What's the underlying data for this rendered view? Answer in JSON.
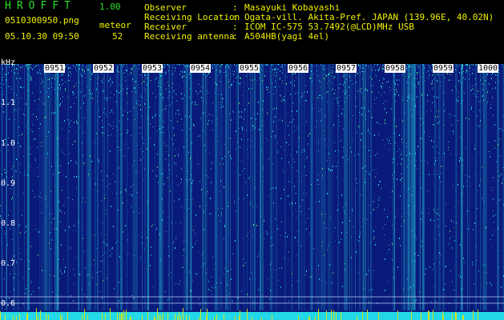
{
  "app": {
    "title": "HROFFT",
    "version": "1.00"
  },
  "file": {
    "name": "0510300950.png",
    "datetime": "05.10.30 09:50"
  },
  "meteor": {
    "label": "meteor",
    "count": "52"
  },
  "info": [
    {
      "label": "Observer",
      "value": "Masayuki Kobayashi"
    },
    {
      "label": "Receiving Location",
      "value": "Ogata-vill. Akita-Pref. JAPAN (139.96E, 40.02N)"
    },
    {
      "label": "Receiver",
      "value": "ICOM IC-575 53.7492(@LCD)MHz USB"
    },
    {
      "label": "Receiving antenna",
      "value": "A504HB(yagi 4el)"
    }
  ],
  "separator": ":",
  "axis": {
    "y_unit": "kHz",
    "y_ticks": [
      "1.1",
      "1.0",
      "0.9",
      "0.8",
      "0.7",
      "0.6"
    ],
    "x_ticks": [
      "0951",
      "0952",
      "0953",
      "0954",
      "0955",
      "0956",
      "0957",
      "0958",
      "0959",
      "1000"
    ]
  },
  "colors": {
    "background": "#0a1a7a",
    "speck_cyan": "#29e0e6",
    "speck_green": "#4fe07a",
    "speck_yellow": "#e8e600",
    "baseline": "#23d8e8",
    "header_green": "#2be02b",
    "header_yellow": "#f0f000"
  }
}
